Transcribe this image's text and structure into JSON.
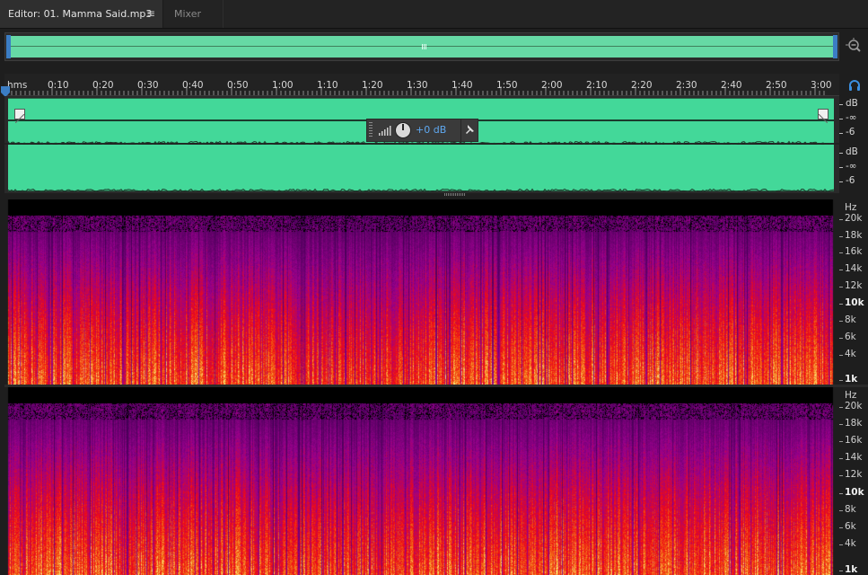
{
  "tabs": {
    "editor_label": "Editor: 01. Mamma Said.mp3",
    "menu_glyph": "≡",
    "mixer_label": "Mixer"
  },
  "timeline": {
    "unit_label": "hms",
    "ticks": [
      "0:10",
      "0:20",
      "0:30",
      "0:40",
      "0:50",
      "1:00",
      "1:10",
      "1:20",
      "1:30",
      "1:40",
      "1:50",
      "2:00",
      "2:10",
      "2:20",
      "2:30",
      "2:40",
      "2:50",
      "3:00"
    ]
  },
  "hud": {
    "volume_label": "+0 dB"
  },
  "db_ruler": {
    "unit": "dB",
    "minus_inf": "-∞",
    "minus_six": "-6"
  },
  "hz_ruler": {
    "unit": "Hz",
    "labels": [
      "20k",
      "18k",
      "16k",
      "14k",
      "12k",
      "10k",
      "8k",
      "6k",
      "4k",
      "1k"
    ]
  },
  "colors": {
    "waveform": "#43d899",
    "overview": "#66d9a5",
    "accent": "#3b7dc4",
    "hud_text": "#5fa8f0"
  },
  "icons": {
    "zoom": "zoom-out-magnifier-icon",
    "playhead": "playhead-marker-icon",
    "headphones": "headphones-icon",
    "meter": "level-meter-icon",
    "knob": "volume-knob-icon",
    "pin": "pin-icon",
    "fade_in": "fade-in-handle-icon",
    "fade_out": "fade-out-handle-icon"
  }
}
